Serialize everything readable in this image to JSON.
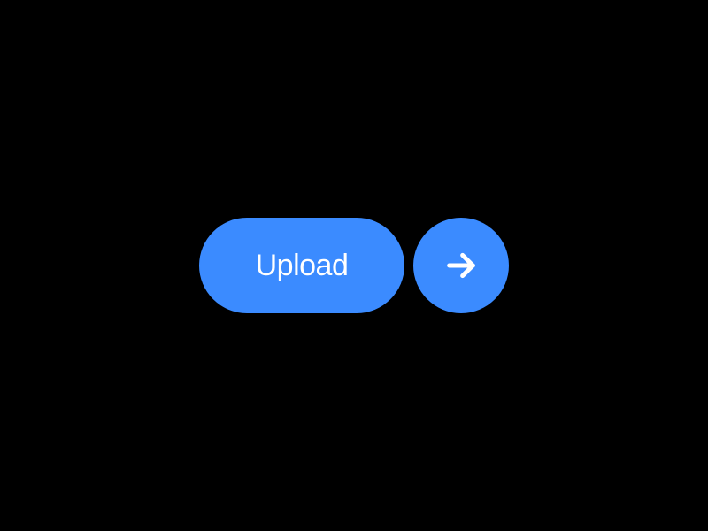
{
  "button": {
    "label": "Upload"
  },
  "colors": {
    "accent": "#3b8bff",
    "text": "#ffffff",
    "background": "#000000"
  }
}
